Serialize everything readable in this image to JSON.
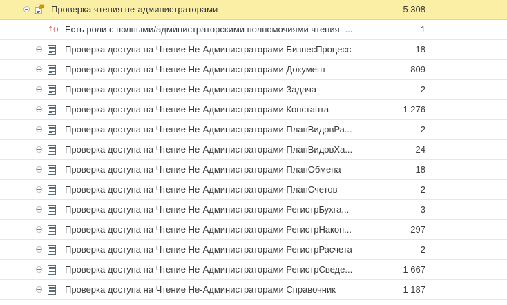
{
  "colors": {
    "header_background": "#fbeea5",
    "function_icon": "#c43a2e"
  },
  "tree": {
    "root": {
      "label": "Проверка чтения не-администраторами",
      "value": "5 308",
      "expanded": true,
      "icon": "group-settings-icon",
      "expander_icon": "collapse-icon"
    },
    "function_item": {
      "icon_text": "f",
      "icon_paren": "()",
      "icon": "function-icon",
      "label": "Есть роли с полными/администраторскими полномочиями чтения -...",
      "value": "1"
    },
    "items": [
      {
        "label": "Проверка доступа на Чтение Не-Администраторами БизнесПроцесс",
        "value": "18"
      },
      {
        "label": "Проверка доступа на Чтение Не-Администраторами Документ",
        "value": "809"
      },
      {
        "label": "Проверка доступа на Чтение Не-Администраторами Задача",
        "value": "2"
      },
      {
        "label": "Проверка доступа на Чтение Не-Администраторами Константа",
        "value": "1 276"
      },
      {
        "label": "Проверка доступа на Чтение Не-Администраторами ПланВидовРа...",
        "value": "2"
      },
      {
        "label": "Проверка доступа на Чтение Не-Администраторами ПланВидовХа...",
        "value": "24"
      },
      {
        "label": "Проверка доступа на Чтение Не-Администраторами ПланОбмена",
        "value": "18"
      },
      {
        "label": "Проверка доступа на Чтение Не-Администраторами ПланСчетов",
        "value": "2"
      },
      {
        "label": "Проверка доступа на Чтение Не-Администраторами РегистрБухга...",
        "value": "3"
      },
      {
        "label": "Проверка доступа на Чтение Не-Администраторами РегистрНакоп...",
        "value": "297"
      },
      {
        "label": "Проверка доступа на Чтение Не-Администраторами РегистрРасчета",
        "value": "2"
      },
      {
        "label": "Проверка доступа на Чтение Не-Администраторами РегистрСведе...",
        "value": "1 667"
      },
      {
        "label": "Проверка доступа на Чтение Не-Администраторами Справочник",
        "value": "1 187"
      }
    ],
    "item_icon": "document-icon",
    "item_expander_icon": "expand-icon"
  }
}
